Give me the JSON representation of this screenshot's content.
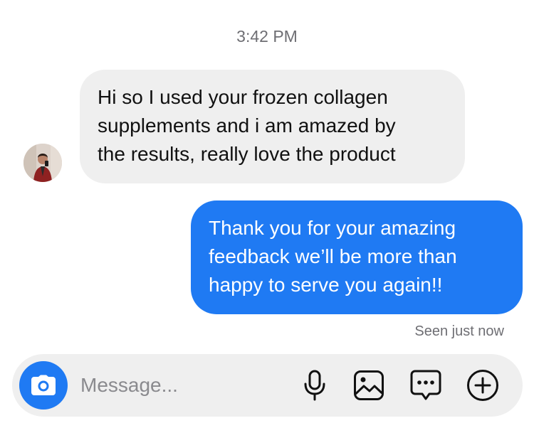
{
  "thread": {
    "timestamp": "3:42 PM",
    "messages": [
      {
        "sender": "other",
        "lines": [
          "Hi so I used your frozen collagen",
          "supplements and i am amazed by",
          "the results, really love the product"
        ]
      },
      {
        "sender": "me",
        "lines": [
          "Thank you for your amazing",
          "feedback we’ll be more than",
          "happy to serve you again!!"
        ]
      }
    ],
    "seen_status": "Seen just now"
  },
  "composer": {
    "placeholder": "Message...",
    "value": "",
    "icons": [
      "camera-icon",
      "microphone-icon",
      "gallery-icon",
      "sticker-icon",
      "plus-icon"
    ]
  },
  "colors": {
    "accent": "#1f7af3",
    "incoming_bubble": "#efefef",
    "meta_text": "#6e6e73"
  }
}
